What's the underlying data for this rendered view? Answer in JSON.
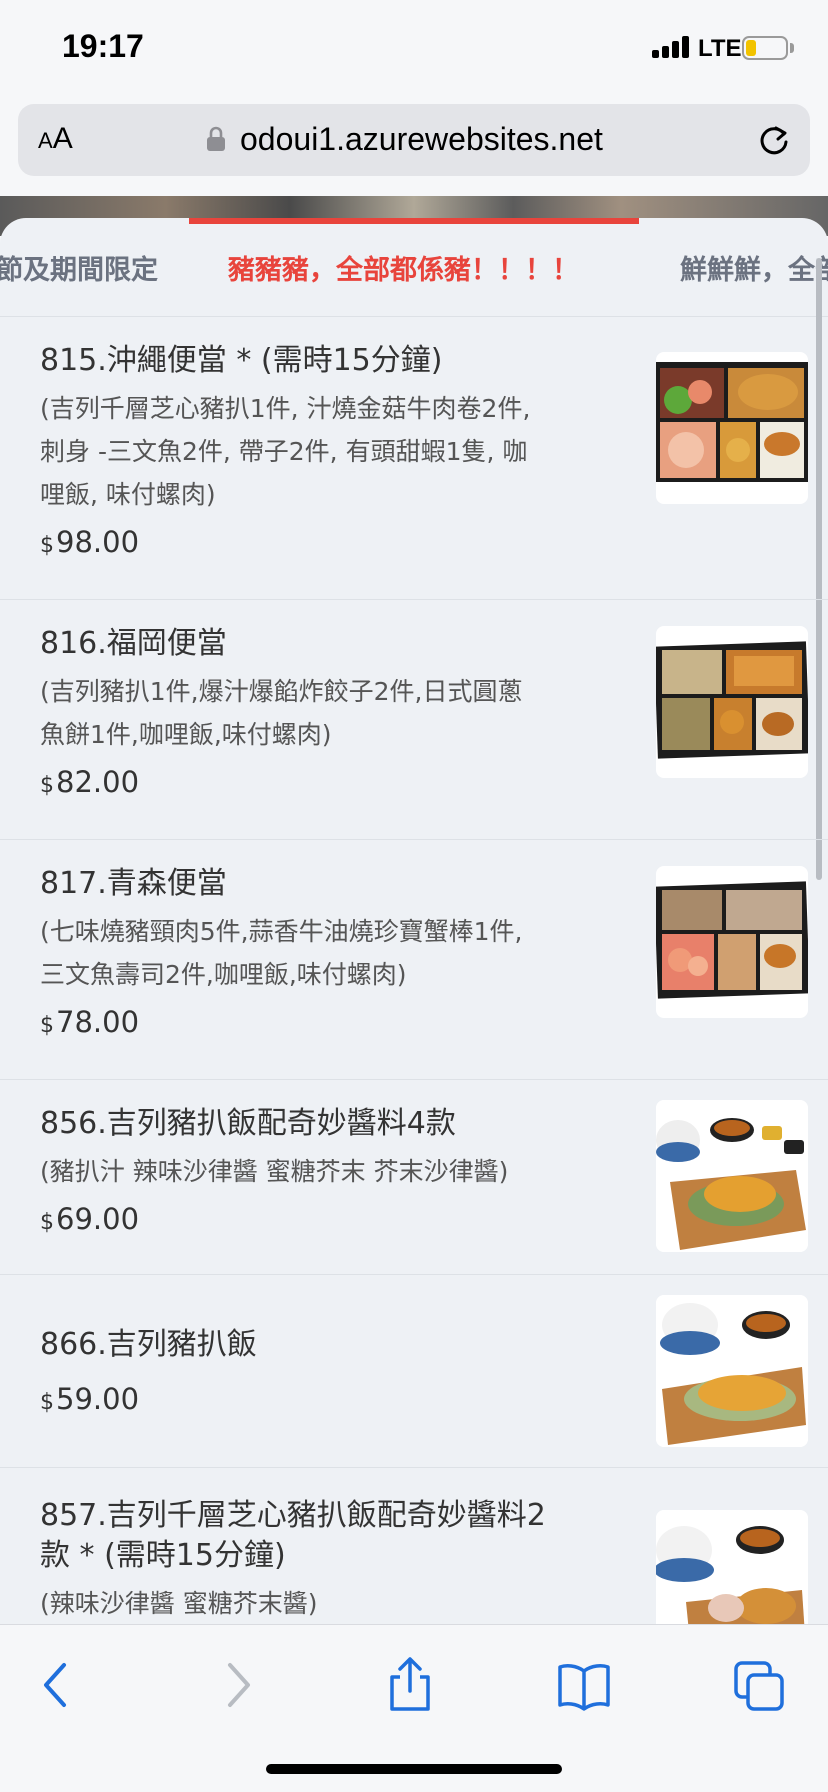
{
  "status": {
    "time": "19:17",
    "network": "LTE",
    "battery_level": 0.22
  },
  "browser": {
    "text_size_label_small": "A",
    "text_size_label_large": "A",
    "url": "odoui1.azurewebsites.net"
  },
  "tabs": [
    {
      "label": "節及期間限定"
    },
    {
      "label": "豬豬豬，全部都係豬！！！！"
    },
    {
      "label": "鮮鮮鮮，全部"
    }
  ],
  "currency_symbol": "$",
  "items": [
    {
      "name": "815.沖繩便當 * (需時15分鐘)",
      "desc": [
        "(吉列千層芝心豬扒1件, 汁燒金菇牛肉卷2件,",
        "刺身 -三文魚2件, 帶子2件, 有頭甜蝦1隻, 咖",
        "哩飯, 味付螺肉)"
      ],
      "price": "98.00"
    },
    {
      "name": "816.福岡便當",
      "desc": [
        "(吉列豬扒1件,爆汁爆餡炸餃子2件,日式圓蔥",
        "魚餅1件,咖哩飯,味付螺肉)"
      ],
      "price": "82.00"
    },
    {
      "name": "817.青森便當",
      "desc": [
        "(七味燒豬頸肉5件,蒜香牛油燒珍寶蟹棒1件,",
        "三文魚壽司2件,咖哩飯,味付螺肉)"
      ],
      "price": "78.00"
    },
    {
      "name": "856.吉列豬扒飯配奇妙醬料4款",
      "desc": [
        "(豬扒汁 辣味沙律醬 蜜糖芥末 芥末沙律醬)"
      ],
      "price": "69.00"
    },
    {
      "name": "866.吉列豬扒飯",
      "desc": [],
      "price": "59.00"
    },
    {
      "name_lines": [
        "857.吉列千層芝心豬扒飯配奇妙醬料2",
        "款 * (需時15分鐘)"
      ],
      "desc": [
        "(辣味沙律醬 蜜糖芥末醬)"
      ],
      "price": ""
    }
  ],
  "toolbar": [
    "back-icon",
    "forward-icon",
    "share-icon",
    "bookmarks-icon",
    "tabs-icon"
  ]
}
